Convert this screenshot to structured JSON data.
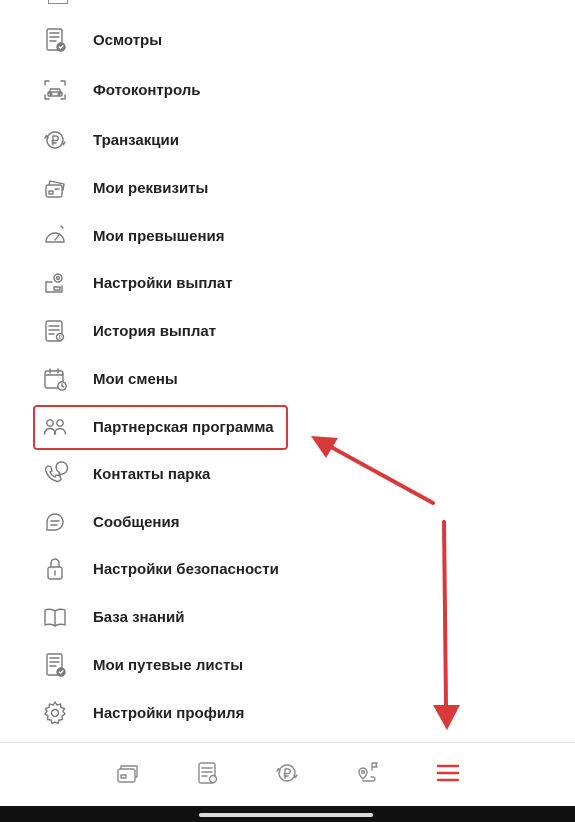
{
  "menu": {
    "items": [
      {
        "label": "Осмотры",
        "icon": "checklist-document-icon"
      },
      {
        "label": "Фотоконтроль",
        "icon": "car-camera-frame-icon"
      },
      {
        "label": "Транзакции",
        "icon": "ruble-transfer-icon"
      },
      {
        "label": "Мои реквизиты",
        "icon": "cards-wallet-icon"
      },
      {
        "label": "Мои превышения",
        "icon": "speedometer-icon"
      },
      {
        "label": "Настройки выплат",
        "icon": "payout-settings-icon"
      },
      {
        "label": "История выплат",
        "icon": "payout-history-icon"
      },
      {
        "label": "Мои смены",
        "icon": "calendar-clock-icon"
      },
      {
        "label": "Партнерская программа",
        "icon": "partners-icon"
      },
      {
        "label": "Контакты парка",
        "icon": "phone-chat-icon"
      },
      {
        "label": "Сообщения",
        "icon": "message-bubble-icon"
      },
      {
        "label": "Настройки безопасности",
        "icon": "lock-icon"
      },
      {
        "label": "База знаний",
        "icon": "open-book-icon"
      },
      {
        "label": "Мои путевые листы",
        "icon": "waybill-icon"
      },
      {
        "label": "Настройки профиля",
        "icon": "gear-icon"
      }
    ]
  },
  "bottom_nav": {
    "items": [
      {
        "name": "nav-cards",
        "icon": "cards-wallet-icon"
      },
      {
        "name": "nav-history",
        "icon": "payout-history-icon"
      },
      {
        "name": "nav-transactions",
        "icon": "ruble-transfer-icon"
      },
      {
        "name": "nav-route",
        "icon": "route-map-icon"
      },
      {
        "name": "nav-menu",
        "icon": "hamburger-menu-icon",
        "active": true
      }
    ]
  },
  "colors": {
    "accent": "#d83a3a",
    "icon_gray": "#7a7a7a",
    "text": "#222222"
  }
}
